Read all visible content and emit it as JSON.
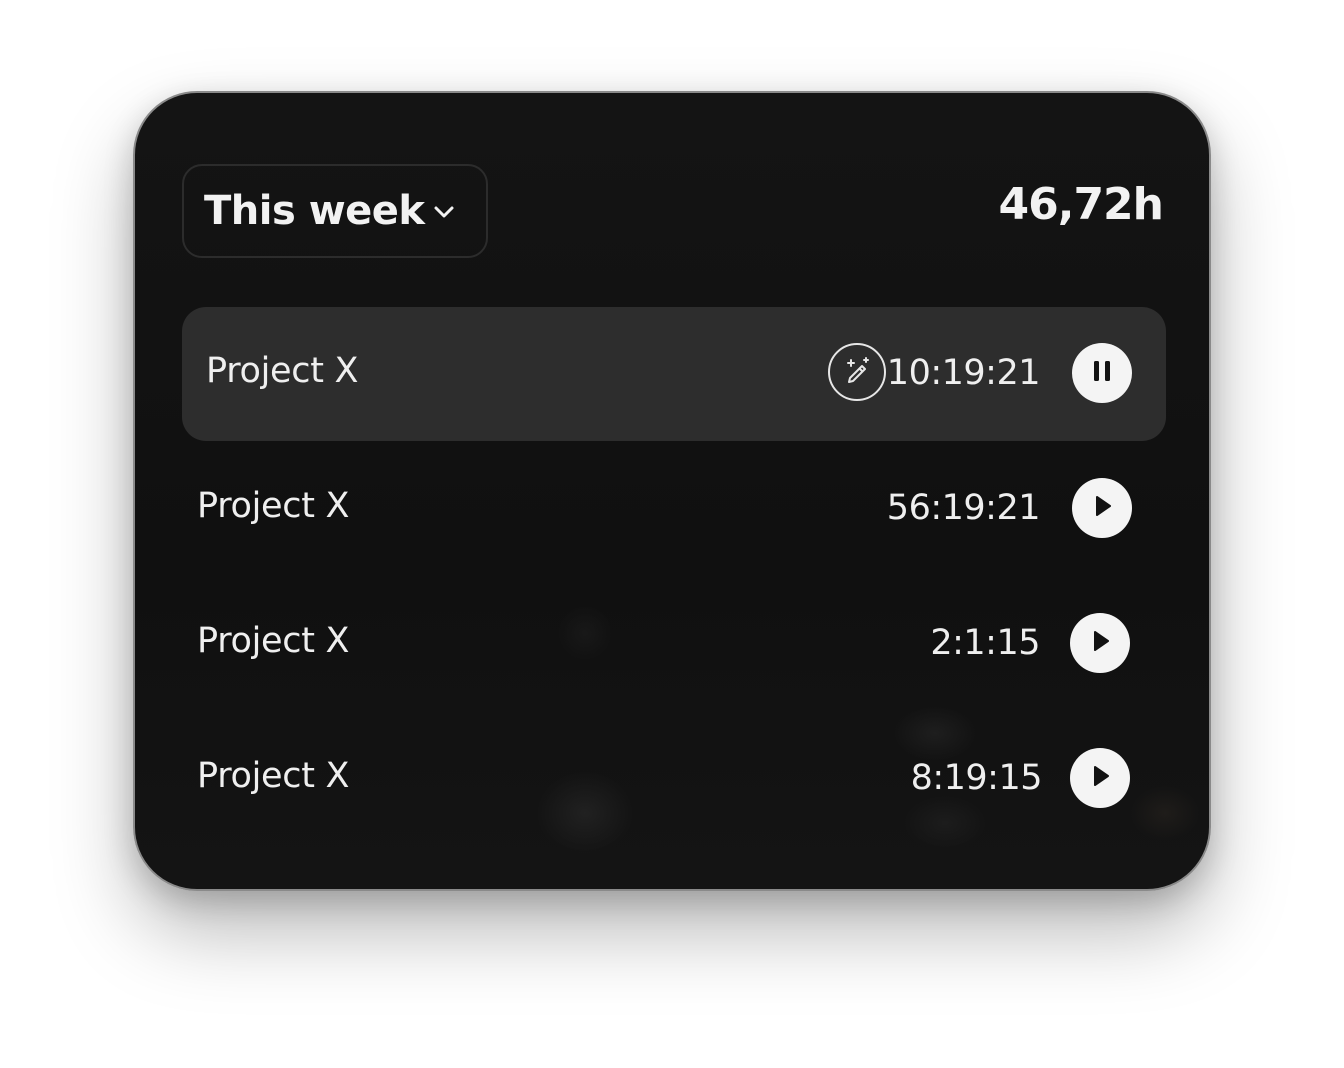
{
  "header": {
    "period_label": "This week",
    "total": "46,72h"
  },
  "entries": [
    {
      "name": "Project X",
      "time": "10:19:21",
      "state": "running",
      "control_icon": "pause-icon",
      "has_magic": true
    },
    {
      "name": "Project X",
      "time": "56:19:21",
      "state": "stopped",
      "control_icon": "play-icon",
      "has_magic": false
    },
    {
      "name": "Project X",
      "time": "2:1:15",
      "state": "stopped",
      "control_icon": "play-icon",
      "has_magic": false
    },
    {
      "name": "Project X",
      "time": "8:19:15",
      "state": "stopped",
      "control_icon": "play-icon",
      "has_magic": false
    }
  ],
  "icons": {
    "dropdown": "chevron-down-icon",
    "magic": "magic-wand-icon"
  },
  "colors": {
    "card_bg": "#121212",
    "active_row_bg": "#2d2d2d",
    "text": "#efefef",
    "button_bg": "#f4f4f4",
    "button_icon": "#121212"
  }
}
